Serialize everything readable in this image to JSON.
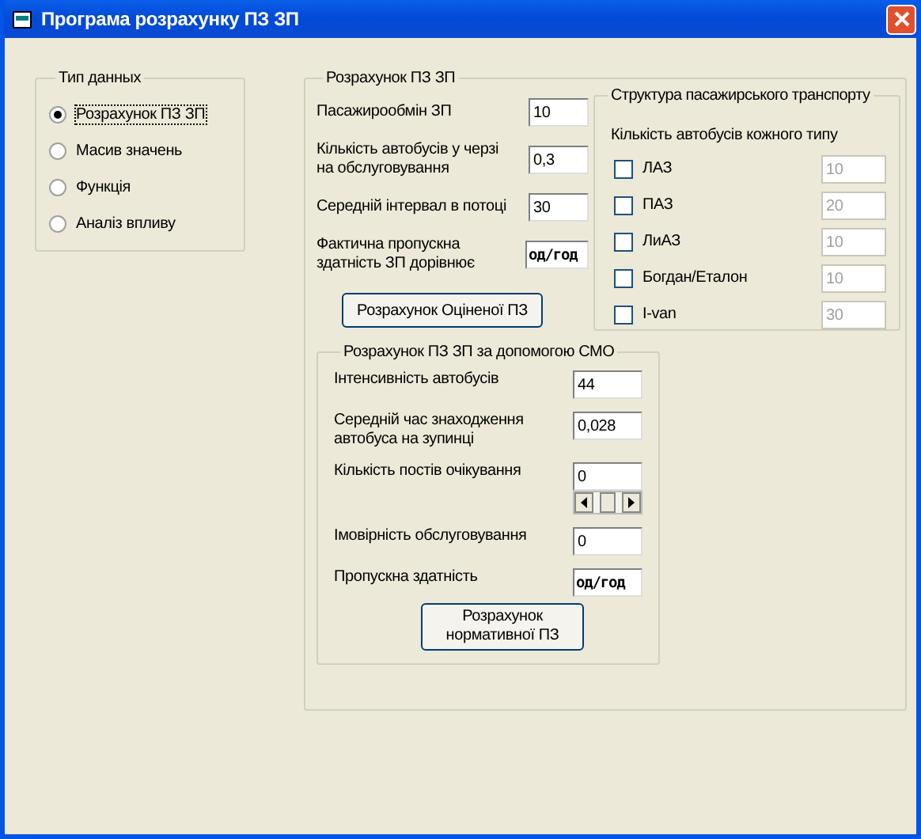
{
  "window": {
    "title": "Програма розрахунку ПЗ ЗП"
  },
  "data_type": {
    "title": "Тип данных",
    "options": [
      {
        "label": "Розрахунок ПЗ ЗП",
        "selected": true
      },
      {
        "label": "Масив значень",
        "selected": false
      },
      {
        "label": "Функція",
        "selected": false
      },
      {
        "label": "Аналіз впливу",
        "selected": false
      }
    ]
  },
  "calculation": {
    "title": "Розрахунок ПЗ ЗП",
    "fields": [
      {
        "kind": "input",
        "label": "Пасажирообмін ЗП",
        "value": "10"
      },
      {
        "kind": "input",
        "label": "Кількість автобусів у черзі на обслуговування",
        "value": "0,3"
      },
      {
        "kind": "input",
        "label": "Середній інтервал в потоці",
        "value": "30"
      },
      {
        "kind": "output",
        "label": "Фактична пропускна здатність ЗП дорівнює",
        "value": "од/год"
      }
    ],
    "button": "Розрахунок Оціненої ПЗ"
  },
  "structure": {
    "title": "Структура пасажирського транспорту",
    "subtitle": "Кількість автобусів кожного типу",
    "buses": [
      {
        "label": "ЛАЗ",
        "checked": false,
        "value": "10"
      },
      {
        "label": "ПАЗ",
        "checked": false,
        "value": "20"
      },
      {
        "label": "ЛиАЗ",
        "checked": false,
        "value": "10"
      },
      {
        "label": "Богдан/Еталон",
        "checked": false,
        "value": "10"
      },
      {
        "label": "I-van",
        "checked": false,
        "value": "30"
      }
    ]
  },
  "smo": {
    "title": "Розрахунок ПЗ ЗП за допомогою СМО",
    "fields": [
      {
        "kind": "input",
        "label": "Інтенсивність автобусів",
        "value": "44"
      },
      {
        "kind": "input",
        "label": "Середній час знаходження автобуса на зупинці",
        "value": "0,028"
      },
      {
        "kind": "spinner",
        "label": "Кількість постів очікування",
        "value": "0"
      },
      {
        "kind": "input",
        "label": "Імовірність обслуговування",
        "value": "0"
      },
      {
        "kind": "output",
        "label": "Пропускна здатність",
        "value": "од/год"
      }
    ],
    "button": "Розрахунок нормативної ПЗ"
  }
}
